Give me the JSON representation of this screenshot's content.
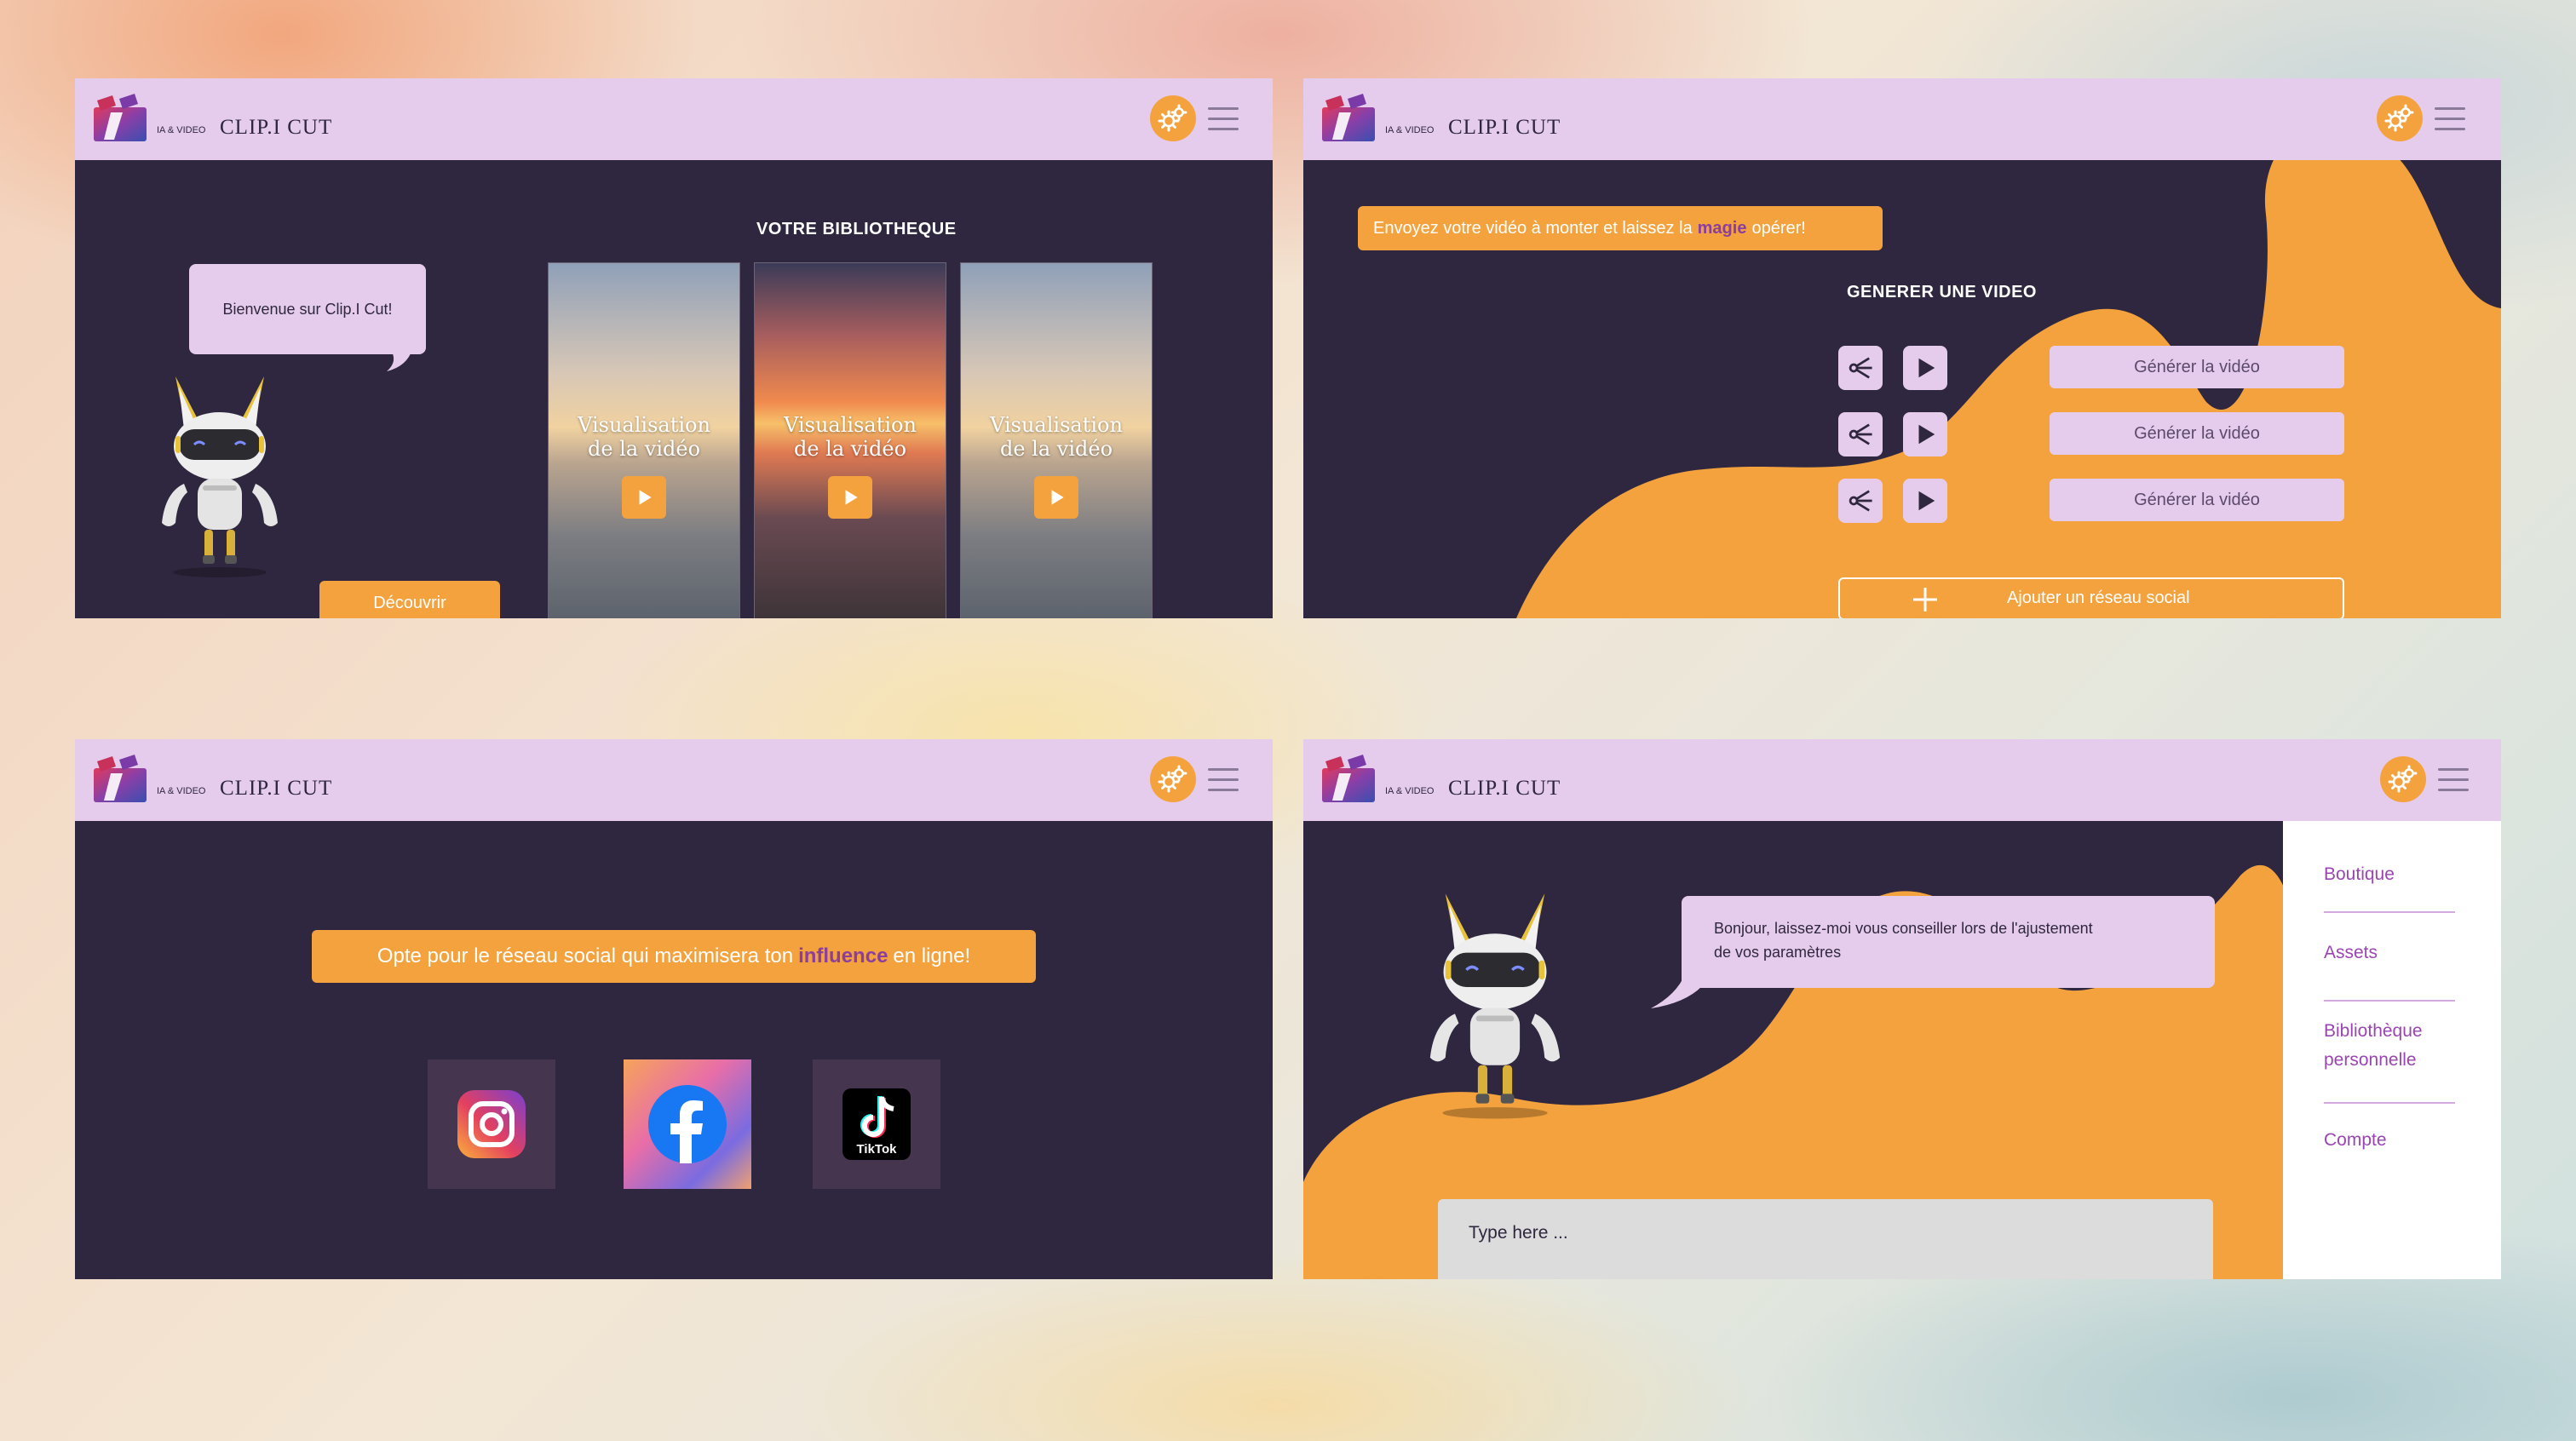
{
  "brand": {
    "tagline": "IA & VIDEO",
    "name": "CLIP.I CUT"
  },
  "icons": {
    "logo": "clip-logo-icon",
    "settings": "gears-icon",
    "menu": "hamburger-menu-icon",
    "play": "play-icon",
    "share": "share-icon",
    "plus": "plus-icon"
  },
  "colors": {
    "header": "#e6ccec",
    "panel": "#2f273f",
    "accent": "#f3a23e",
    "highlight": "#8b3e9e"
  },
  "library": {
    "greeting": "Bienvenue sur Clip.I Cut!",
    "discover_label": "Découvrir",
    "title": "VOTRE BIBLIOTHEQUE",
    "videos": [
      {
        "caption_line1": "Visualisation",
        "caption_line2": "de la vidéo"
      },
      {
        "caption_line1": "Visualisation",
        "caption_line2": "de la vidéo"
      },
      {
        "caption_line1": "Visualisation",
        "caption_line2": "de la vidéo"
      }
    ]
  },
  "generate": {
    "banner_before": "Envoyez votre vidéo à monter et laissez la",
    "banner_highlight": "magie",
    "banner_after": "opérer!",
    "title": "GENERER UNE VIDEO",
    "rows": [
      {
        "button_label": "Générer la vidéo"
      },
      {
        "button_label": "Générer la vidéo"
      },
      {
        "button_label": "Générer la vidéo"
      }
    ],
    "add_social_label": "Ajouter un réseau social"
  },
  "social": {
    "banner_before": "Opte pour le réseau social qui maximisera ton",
    "banner_highlight": "influence",
    "banner_after": "en ligne!",
    "networks": [
      {
        "name": "instagram",
        "icon": "instagram-icon"
      },
      {
        "name": "facebook",
        "icon": "facebook-icon"
      },
      {
        "name": "tiktok",
        "icon": "tiktok-icon",
        "label": "TikTok"
      }
    ]
  },
  "assistant": {
    "message_line1": "Bonjour, laissez-moi vous conseiller lors de l'ajustement",
    "message_line2": "de vos paramètres",
    "input_placeholder": "Type here ...",
    "menu": [
      {
        "label": "Boutique"
      },
      {
        "label": "Assets"
      },
      {
        "label_line1": "Bibliothèque",
        "label_line2": "personnelle"
      },
      {
        "label": "Compte"
      }
    ]
  }
}
